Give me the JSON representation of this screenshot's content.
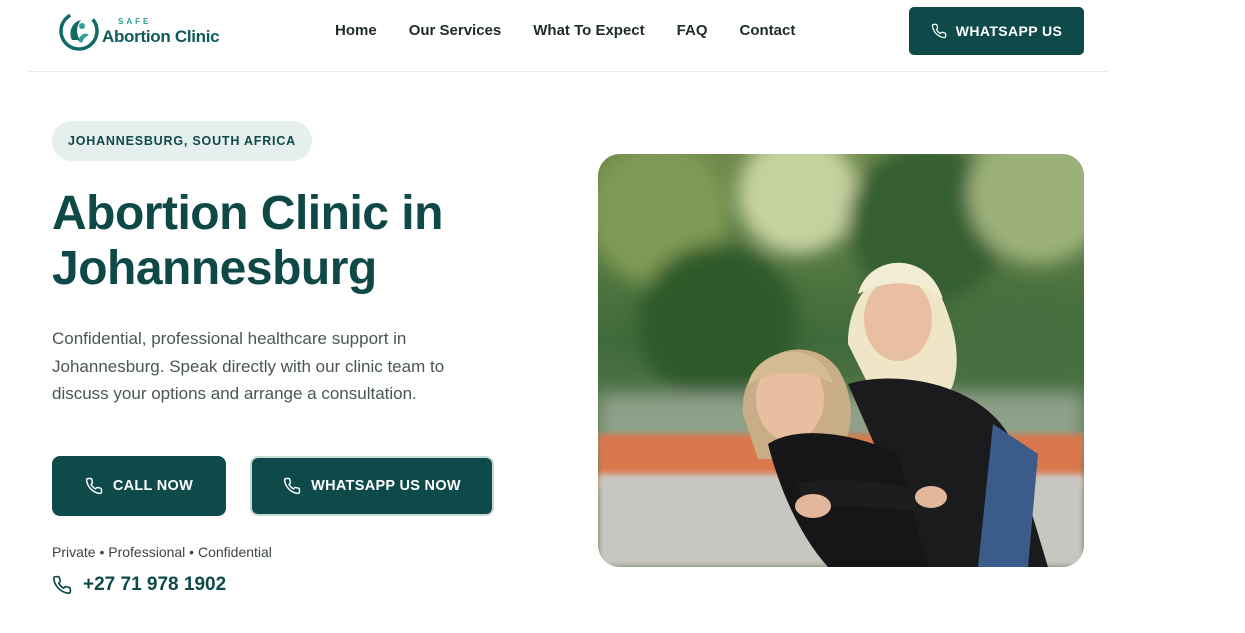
{
  "brand": {
    "safe": "SAFE",
    "name": "Abortion Clinic"
  },
  "nav": [
    "Home",
    "Our Services",
    "What To Expect",
    "FAQ",
    "Contact"
  ],
  "header_cta": "WHATSAPP US",
  "hero": {
    "location": "JOHANNESBURG, SOUTH AFRICA",
    "title_line1": "Abortion Clinic in",
    "title_line2": "Johannesburg",
    "description": "Confidential, professional healthcare support in Johannesburg. Speak directly with our clinic team to discuss your options and arrange a consultation.",
    "call_button": "CALL NOW",
    "whatsapp_button": "WHATSAPP US NOW",
    "tagline": "Private • Professional • Confidential",
    "phone": "+27 71 978 1902",
    "image_subject": "two smiling young women, one giving the other a piggyback ride outdoors"
  },
  "colors": {
    "primary": "#0d4a49",
    "accent": "#2f9d94",
    "pill_bg": "#e5efed",
    "text_muted": "#4a5656"
  },
  "icons": [
    "clinic-logo-icon",
    "phone-icon"
  ]
}
